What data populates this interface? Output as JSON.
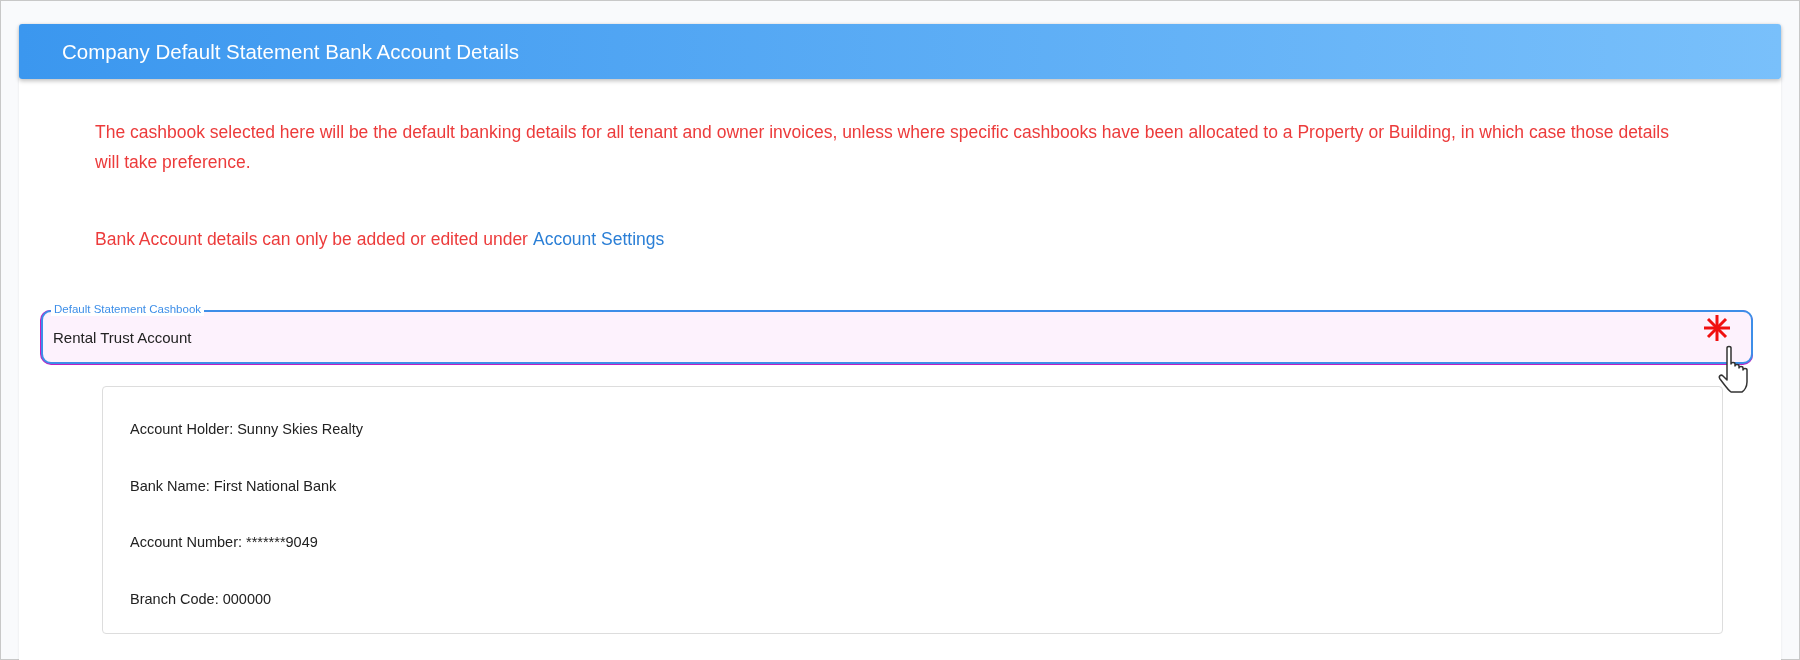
{
  "panel": {
    "title": "Company Default Statement Bank Account Details"
  },
  "notice": "The cashbook selected here will be the default banking details for all tenant and owner invoices, unless where specific cashbooks have been allocated to a Property or Building, in which case those details will take preference.",
  "settings_note": {
    "text": "Bank Account details can only be added or edited under",
    "link": "Account Settings"
  },
  "cashbook_field": {
    "label": "Default Statement Cashbook",
    "value": "Rental Trust Account",
    "required": true
  },
  "account_details": [
    {
      "text": "Account Holder: Sunny Skies Realty"
    },
    {
      "text": "Bank Name: First National Bank"
    },
    {
      "text": "Account Number: *******9049"
    },
    {
      "text": "Branch Code: 000000"
    }
  ]
}
